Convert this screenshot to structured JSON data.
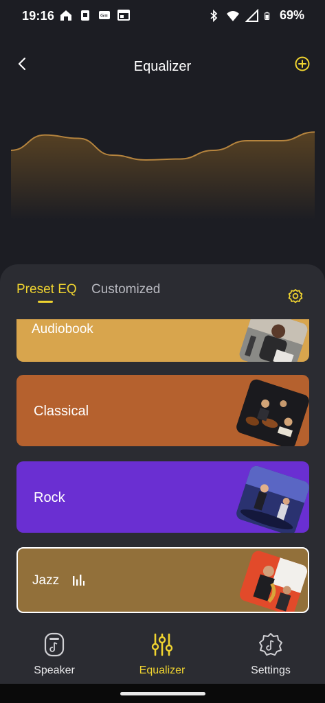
{
  "status_bar": {
    "time": "19:16",
    "battery": "69%",
    "left_icons": [
      "home-icon",
      "sim-icon",
      "gallery-icon",
      "calendar-icon"
    ],
    "right_icons": [
      "bluetooth-icon",
      "wifi-icon",
      "signal-icon",
      "battery-icon"
    ]
  },
  "header": {
    "title": "Equalizer",
    "back_icon": "chevron-left-icon",
    "add_icon": "plus-circle-icon"
  },
  "colors": {
    "background": "#1c1d23",
    "panel": "#2b2c32",
    "accent": "#f0d430",
    "eq_curve": "#b5843e"
  },
  "eq_curve": {
    "bands": 10,
    "levels": [
      0.3,
      0.62,
      0.55,
      0.2,
      0.1,
      0.12,
      0.3,
      0.5,
      0.5,
      0.68
    ]
  },
  "tabs": [
    {
      "label": "Preset EQ",
      "active": true
    },
    {
      "label": "Customized",
      "active": false
    }
  ],
  "presets": [
    {
      "label": "Audiobook",
      "color": "#d8a54d",
      "selected": false
    },
    {
      "label": "Classical",
      "color": "#b5612e",
      "selected": false
    },
    {
      "label": "Rock",
      "color": "#6a2fd2",
      "selected": false
    },
    {
      "label": "Jazz",
      "color": "#92703a",
      "selected": true,
      "playing_icon": "equalizer-bars-icon"
    }
  ],
  "bottom_nav": [
    {
      "label": "Speaker",
      "icon": "speaker-icon",
      "active": false
    },
    {
      "label": "Equalizer",
      "icon": "sliders-icon",
      "active": true
    },
    {
      "label": "Settings",
      "icon": "settings-music-icon",
      "active": false
    }
  ]
}
